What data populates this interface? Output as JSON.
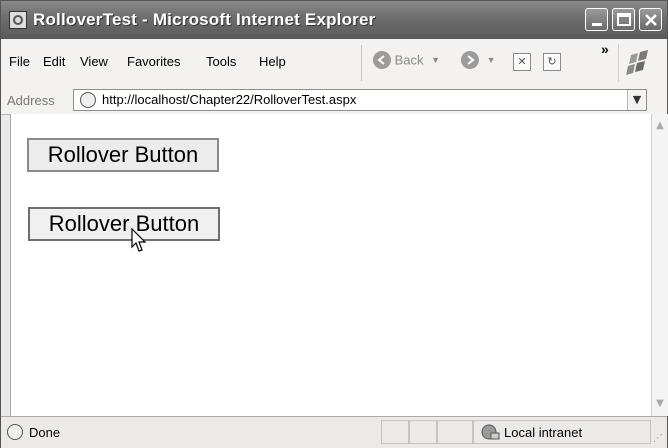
{
  "window": {
    "title": "RolloverTest - Microsoft Internet Explorer"
  },
  "menubar": {
    "items": [
      "File",
      "Edit",
      "View",
      "Favorites",
      "Tools",
      "Help"
    ],
    "back_label": "Back",
    "chevron": "»"
  },
  "address": {
    "label": "Address",
    "url": "http://localhost/Chapter22/RolloverTest.aspx"
  },
  "content": {
    "button1_label": "Rollover Button",
    "button2_label": "Rollover Button"
  },
  "status": {
    "text": "Done",
    "zone": "Local intranet"
  }
}
